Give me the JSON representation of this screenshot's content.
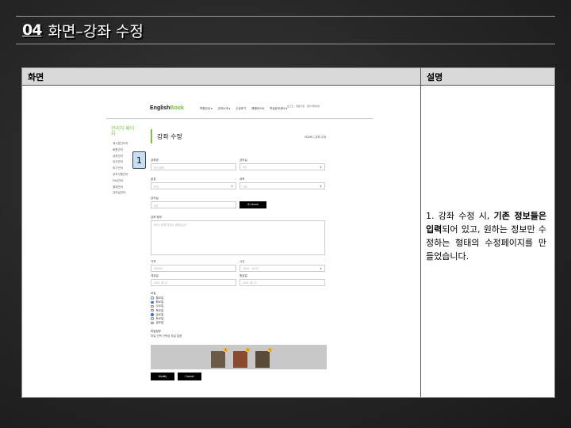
{
  "slide": {
    "number": "04",
    "title": "화면–강좌 수정"
  },
  "table": {
    "col_screen": "화면",
    "col_desc": "설명",
    "desc_line1": "1. 강좌 수정 시, ",
    "desc_bold": "기존 정보들은 입력",
    "desc_line2": "되어 있고, 원하는 정보만 수정하는 형태의 수정페이지를 만들었습니다."
  },
  "mock": {
    "logo_a": "English",
    "logo_b": "Book",
    "gnb": [
      "학원안내 ▾",
      "강의소개 ▾",
      "수강후기",
      "예행테스트",
      "학습문의센터 ▾"
    ],
    "util": "로그인 · 회원가입 · 관리자페이지",
    "side_title": "관리자 페이지",
    "side_menu": [
      "게시판관리자",
      "회원관리",
      "강좌관리",
      "강사관리",
      "후기관리",
      "공지사항관리",
      "FAQ관리",
      "결제관리",
      "강의실관리"
    ],
    "page_heading": "강좌 수정",
    "breadcrumb": "HOME | 강좌 수정",
    "badge": "1",
    "labels": {
      "name": "강좌명",
      "level": "강의실",
      "category": "분류",
      "teacher": "과목",
      "roomno": "강의실",
      "desc": "강좌 정보",
      "price": "가격",
      "time": "시간",
      "start": "개강일",
      "end": "종강일",
      "days": "요일",
      "file": "파일첨부"
    },
    "values": {
      "name": "토익 공략",
      "level": "301",
      "category": "토익",
      "teacher": "기초",
      "roomno": "A관",
      "desc": "토익 기초를 다지는 강좌입니다.",
      "price": "300000",
      "time": "18:00 ~ 20:00",
      "start": "2018. 08. 01",
      "end": "2018. 08. 31"
    },
    "check_button": "ID check",
    "days": [
      "월요일",
      "화요일",
      "수요일",
      "목요일",
      "금요일",
      "토요일",
      "일요일"
    ],
    "days_checked": [
      false,
      true,
      false,
      false,
      true,
      false,
      false
    ],
    "file_note": "파일 선택   선택된 파일 없음",
    "modify_button": "Modify",
    "cancel_button": "Cancel",
    "thumb_colors": [
      "#6b5a48",
      "#8a4a30",
      "#5a4a3a"
    ]
  }
}
